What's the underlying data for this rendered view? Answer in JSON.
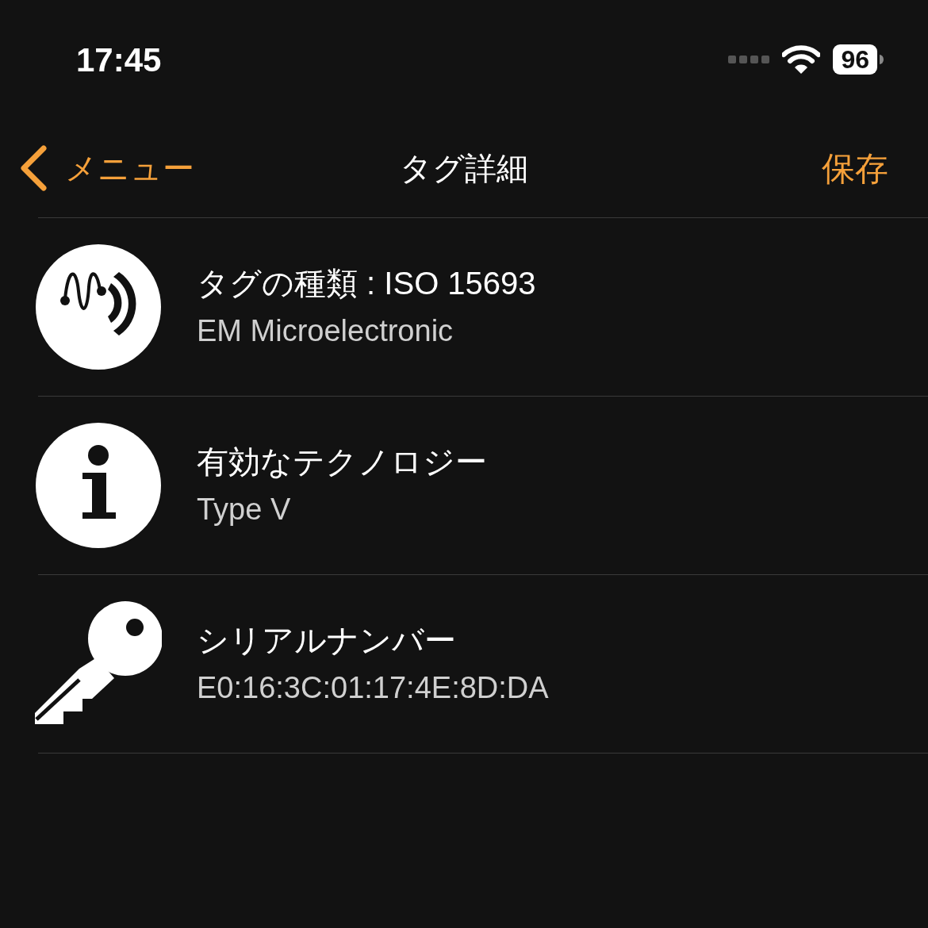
{
  "status_bar": {
    "time": "17:45",
    "battery": "96"
  },
  "nav": {
    "back": "メニュー",
    "title": "タグ詳細",
    "action": "保存"
  },
  "rows": [
    {
      "kind": "tag",
      "title": "タグの種類 : ISO 15693",
      "subtitle": "EM Microelectronic"
    },
    {
      "kind": "info",
      "title": "有効なテクノロジー",
      "subtitle": "Type V"
    },
    {
      "kind": "key",
      "title": "シリアルナンバー",
      "subtitle": "E0:16:3C:01:17:4E:8D:DA"
    }
  ]
}
